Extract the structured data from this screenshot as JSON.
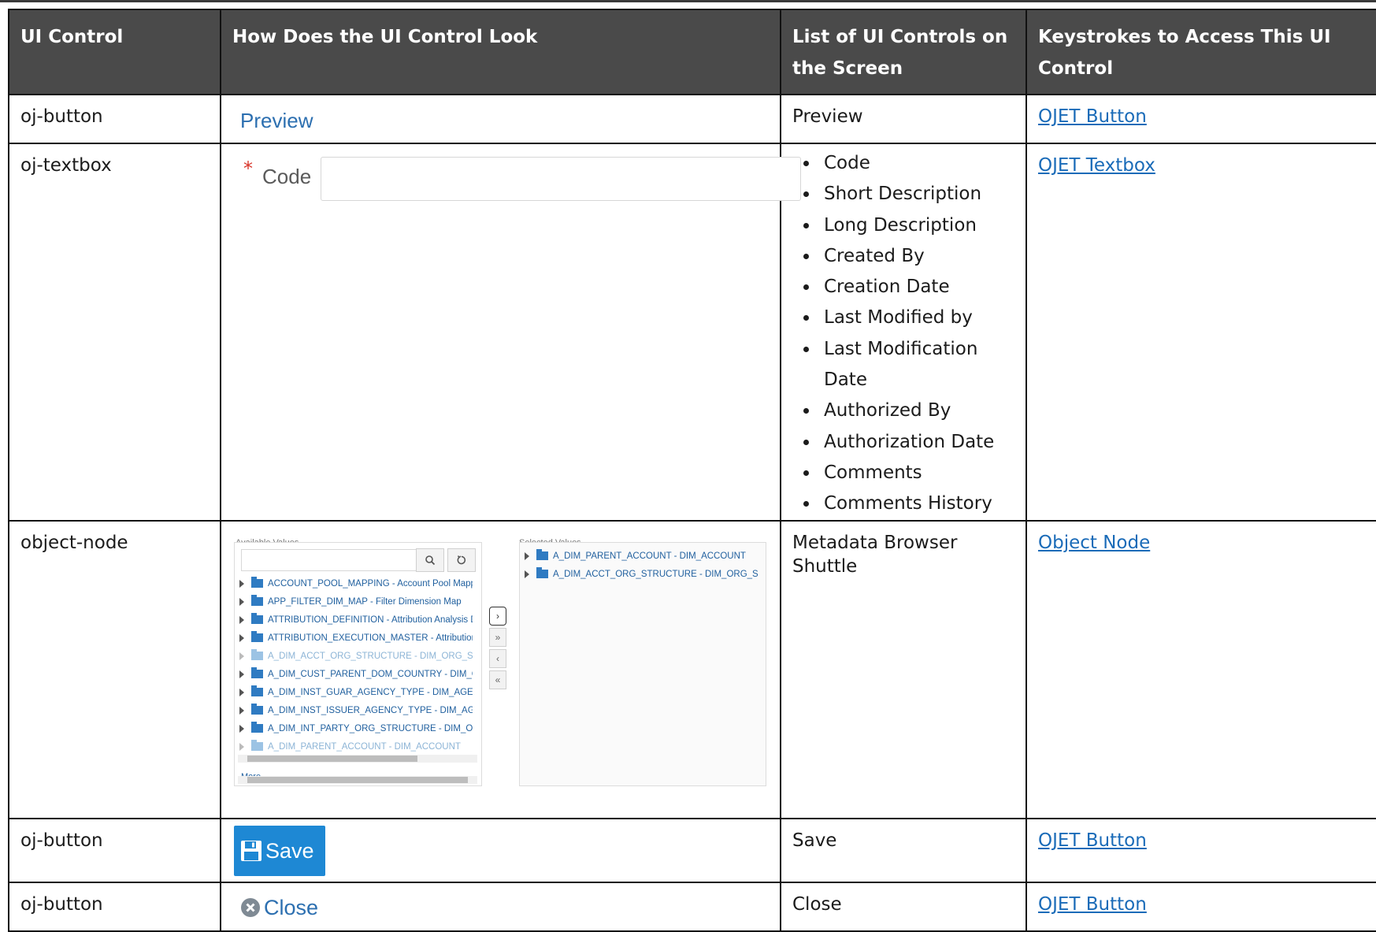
{
  "table": {
    "headers": [
      "UI Control",
      "How Does the UI Control Look",
      "List of UI Controls on the Screen",
      "Keystrokes to Access This UI Control"
    ],
    "rows": [
      {
        "control": "oj-button",
        "look_label": "Preview",
        "list": "Preview",
        "link": "OJET Button"
      },
      {
        "control": "oj-textbox",
        "look_label": "Code",
        "list_items": [
          "Code",
          "Short Description",
          "Long Description",
          "Created By",
          "Creation Date",
          "Last Modified by",
          "Last Modification Date",
          "Authorized By",
          "Authorization Date",
          "Comments",
          "Comments History"
        ],
        "link": "OJET Textbox"
      },
      {
        "control": "object-node",
        "list": "Metadata Browser Shuttle",
        "link": "Object Node"
      },
      {
        "control": "oj-button",
        "look_label": "Save",
        "list": "Save",
        "link": "OJET Button"
      },
      {
        "control": "oj-button",
        "look_label": "Close",
        "list": "Close",
        "link": "OJET Button"
      }
    ]
  },
  "shuttle": {
    "available_label": "Available Values",
    "selected_label": "Selected Values",
    "available_items": [
      {
        "text": "ACCOUNT_POOL_MAPPING - Account Pool Mapping",
        "dim": false
      },
      {
        "text": "APP_FILTER_DIM_MAP - Filter Dimension Map",
        "dim": false
      },
      {
        "text": "ATTRIBUTION_DEFINITION - Attribution Analysis Definitio",
        "dim": false
      },
      {
        "text": "ATTRIBUTION_EXECUTION_MASTER - Attribution Analysis",
        "dim": false
      },
      {
        "text": "A_DIM_ACCT_ORG_STRUCTURE - DIM_ORG_STRUCTURE",
        "dim": true
      },
      {
        "text": "A_DIM_CUST_PARENT_DOM_COUNTRY - DIM_COUNTRY",
        "dim": false
      },
      {
        "text": "A_DIM_INST_GUAR_AGENCY_TYPE - DIM_AGENCY_TYPE",
        "dim": false
      },
      {
        "text": "A_DIM_INST_ISSUER_AGENCY_TYPE - DIM_AGENCY_TYPE",
        "dim": false
      },
      {
        "text": "A_DIM_INT_PARTY_ORG_STRUCTURE - DIM_ORG_STRUCTI",
        "dim": false
      },
      {
        "text": "A_DIM_PARENT_ACCOUNT - DIM_ACCOUNT",
        "dim": true
      }
    ],
    "selected_items": [
      "A_DIM_PARENT_ACCOUNT - DIM_ACCOUNT",
      "A_DIM_ACCT_ORG_STRUCTURE - DIM_ORG_STRUCTURE"
    ],
    "more_label": "More",
    "move_buttons": [
      "›",
      "»",
      "‹",
      "«"
    ]
  },
  "colors": {
    "header_bg": "#4a4a4a",
    "link": "#1a6bb8",
    "save_button": "#1e88d4",
    "required_star": "#d8352a"
  }
}
